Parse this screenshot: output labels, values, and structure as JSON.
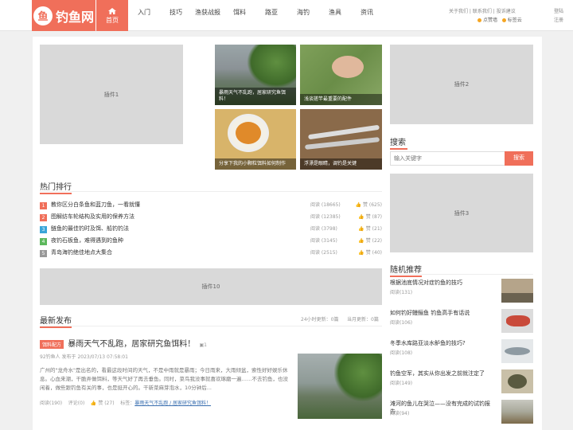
{
  "header": {
    "logo_text": "钓鱼网",
    "logo_glyph": "鱼",
    "nav": [
      {
        "label": "首页",
        "active": true
      },
      {
        "label": "入门"
      },
      {
        "label": "技巧"
      },
      {
        "label": "渔获战报"
      },
      {
        "label": "饵料"
      },
      {
        "label": "路亚"
      },
      {
        "label": "海钓"
      },
      {
        "label": "渔具"
      },
      {
        "label": "资讯"
      }
    ],
    "links": {
      "about": "关于我们",
      "contact": "联系我们",
      "feedback": "投诉建议"
    },
    "login": "登陆",
    "register": "注册",
    "like": "点赞墙",
    "sign": "标签云"
  },
  "plugins": {
    "p1": "插件1",
    "p2": "插件2",
    "p3": "插件3",
    "p10": "插件10"
  },
  "gallery": [
    {
      "caption": "暴雨天气不乱跑，居家研究鱼饵料！"
    },
    {
      "caption": "浅谈搓竿最重要的配件"
    },
    {
      "caption": "分享下我的小颗粒饵料如何制作"
    },
    {
      "caption": "浮漂是眼睛，调钓是关键"
    }
  ],
  "hot": {
    "title": "热门排行",
    "items": [
      {
        "n": "1",
        "title": "教你区分白条鱼和蓝刀鱼，一看就懂",
        "reads": "阅读 (18665)",
        "likes": "赞 (625)",
        "color": "#f06f5a"
      },
      {
        "n": "2",
        "title": "图解纺车轮结构及实用的保养方法",
        "reads": "阅读 (12385)",
        "likes": "赞 (87)",
        "color": "#f06f5a"
      },
      {
        "n": "3",
        "title": "鲢鱼的最佳钓时及饵、船钓钓法",
        "reads": "阅读 (3798)",
        "likes": "赞 (21)",
        "color": "#3aa5d8"
      },
      {
        "n": "4",
        "title": "夜钓石板鱼，难得遇到的鱼种",
        "reads": "阅读 (3145)",
        "likes": "赞 (22)",
        "color": "#5cb85c"
      },
      {
        "n": "5",
        "title": "青岛海钓绝佳地点大集合",
        "reads": "阅读 (2515)",
        "likes": "赞 (40)",
        "color": "#999999"
      }
    ]
  },
  "latest": {
    "title": "最新发布",
    "stat24": "24小时更新：0篇",
    "statday": "当月更新：0篇",
    "post": {
      "tag": "饵料配方",
      "title": "暴雨天气不乱跑，居家研究鱼饵料！",
      "imgcount": "1",
      "meta": "92钓鱼人 发布于 2023/07/13 07:58:01",
      "excerpt": "广州的\"龙舟水\"是出名的，看最这段时间的天气，不是中雨就是暴雨；今日雨来，大雨倾盆，索性好好娱乐休息。心血来潮，干脆弄做饵料，等天气好了再去垂鱼。同时，菜鸟我没事就喜欢琢磨一遍……不去钓鱼，也没闲着，做些跟钓鱼有关的事，也是挺开心的。干新菜麻芽泡水，10分钟后...",
      "reads": "阅读(190)",
      "comments": "评论(0)",
      "likes": "赞 (27)",
      "tags_label": "标签：",
      "tags": "暴雨天气不乱跑 / 居家研究鱼饵料！"
    }
  },
  "search": {
    "title": "搜索",
    "placeholder": "输入关键字",
    "button": "搜索"
  },
  "random": {
    "title": "随机推荐",
    "items": [
      {
        "title": "根据池底情况对症钓鱼的技巧",
        "reads": "阅读(131)"
      },
      {
        "title": "如何钓好鳗鲡鱼 钓鱼高手有话说",
        "reads": "阅读(106)"
      },
      {
        "title": "冬季水库路亚淡水鲈鱼的技巧?",
        "reads": "阅读(108)"
      },
      {
        "title": "钓鱼空军，其实从你出发之前就注定了",
        "reads": "阅读(149)"
      },
      {
        "title": "滩河的鱼儿在哭泣——没有完成的试钓报告",
        "reads": "阅读(94)"
      }
    ]
  }
}
